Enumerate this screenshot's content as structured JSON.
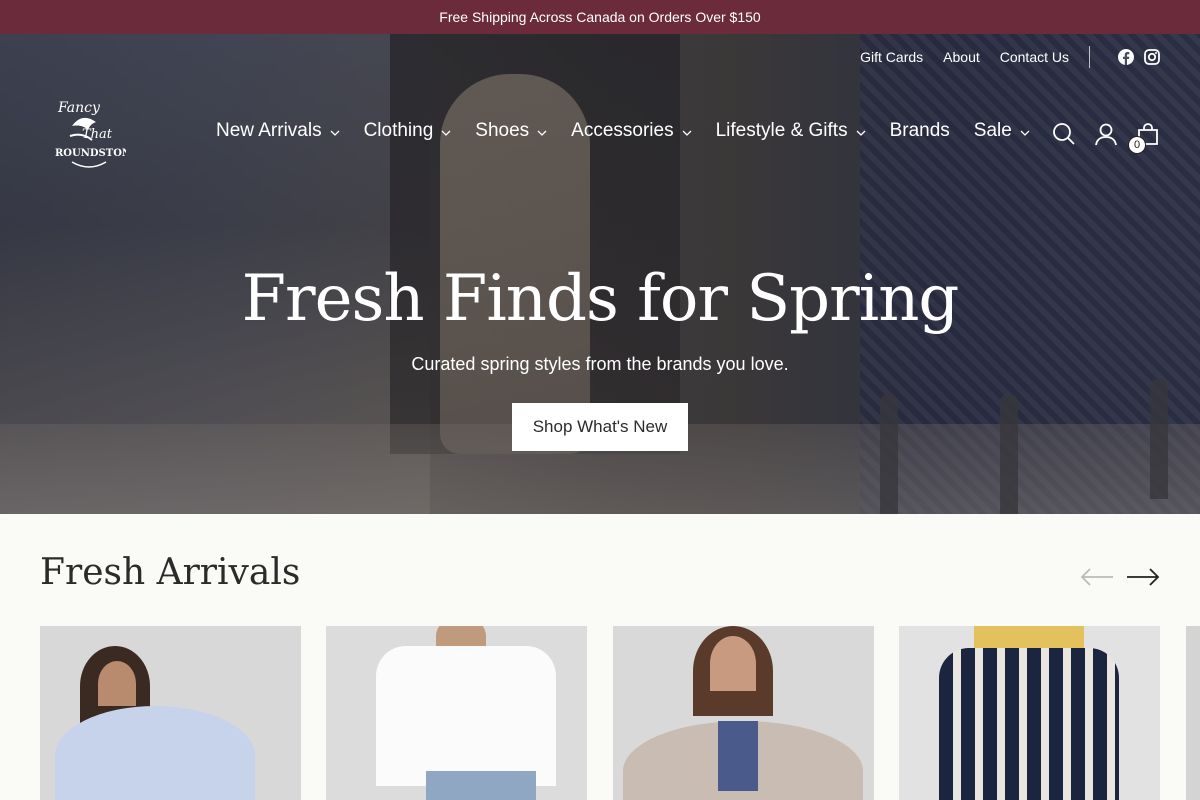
{
  "announcement": "Free Shipping Across Canada on Orders Over $150",
  "utility_nav": {
    "links": [
      "Gift Cards",
      "About",
      "Contact Us"
    ],
    "social": [
      "facebook-icon",
      "instagram-icon"
    ]
  },
  "brand": {
    "logo_text": [
      "Fancy",
      "That",
      "ROUNDSTONE"
    ]
  },
  "main_nav": [
    {
      "label": "New Arrivals",
      "has_dropdown": true
    },
    {
      "label": "Clothing",
      "has_dropdown": true
    },
    {
      "label": "Shoes",
      "has_dropdown": true
    },
    {
      "label": "Accessories",
      "has_dropdown": true
    },
    {
      "label": "Lifestyle & Gifts",
      "has_dropdown": true
    },
    {
      "label": "Brands",
      "has_dropdown": false
    },
    {
      "label": "Sale",
      "has_dropdown": true
    }
  ],
  "header_icons": {
    "search": "search-icon",
    "account": "account-icon",
    "cart": "cart-icon",
    "cart_count": "0"
  },
  "hero": {
    "title": "Fresh Finds for Spring",
    "subtitle": "Curated spring styles from the brands you love.",
    "cta": "Shop What's New"
  },
  "fresh_arrivals": {
    "title": "Fresh Arrivals",
    "prev_arrow": "arrow-left-icon",
    "next_arrow": "arrow-right-icon"
  },
  "colors": {
    "announcement_bg": "#6b2b3a",
    "page_bg": "#fafaf7",
    "text": "#2b2b2b"
  }
}
